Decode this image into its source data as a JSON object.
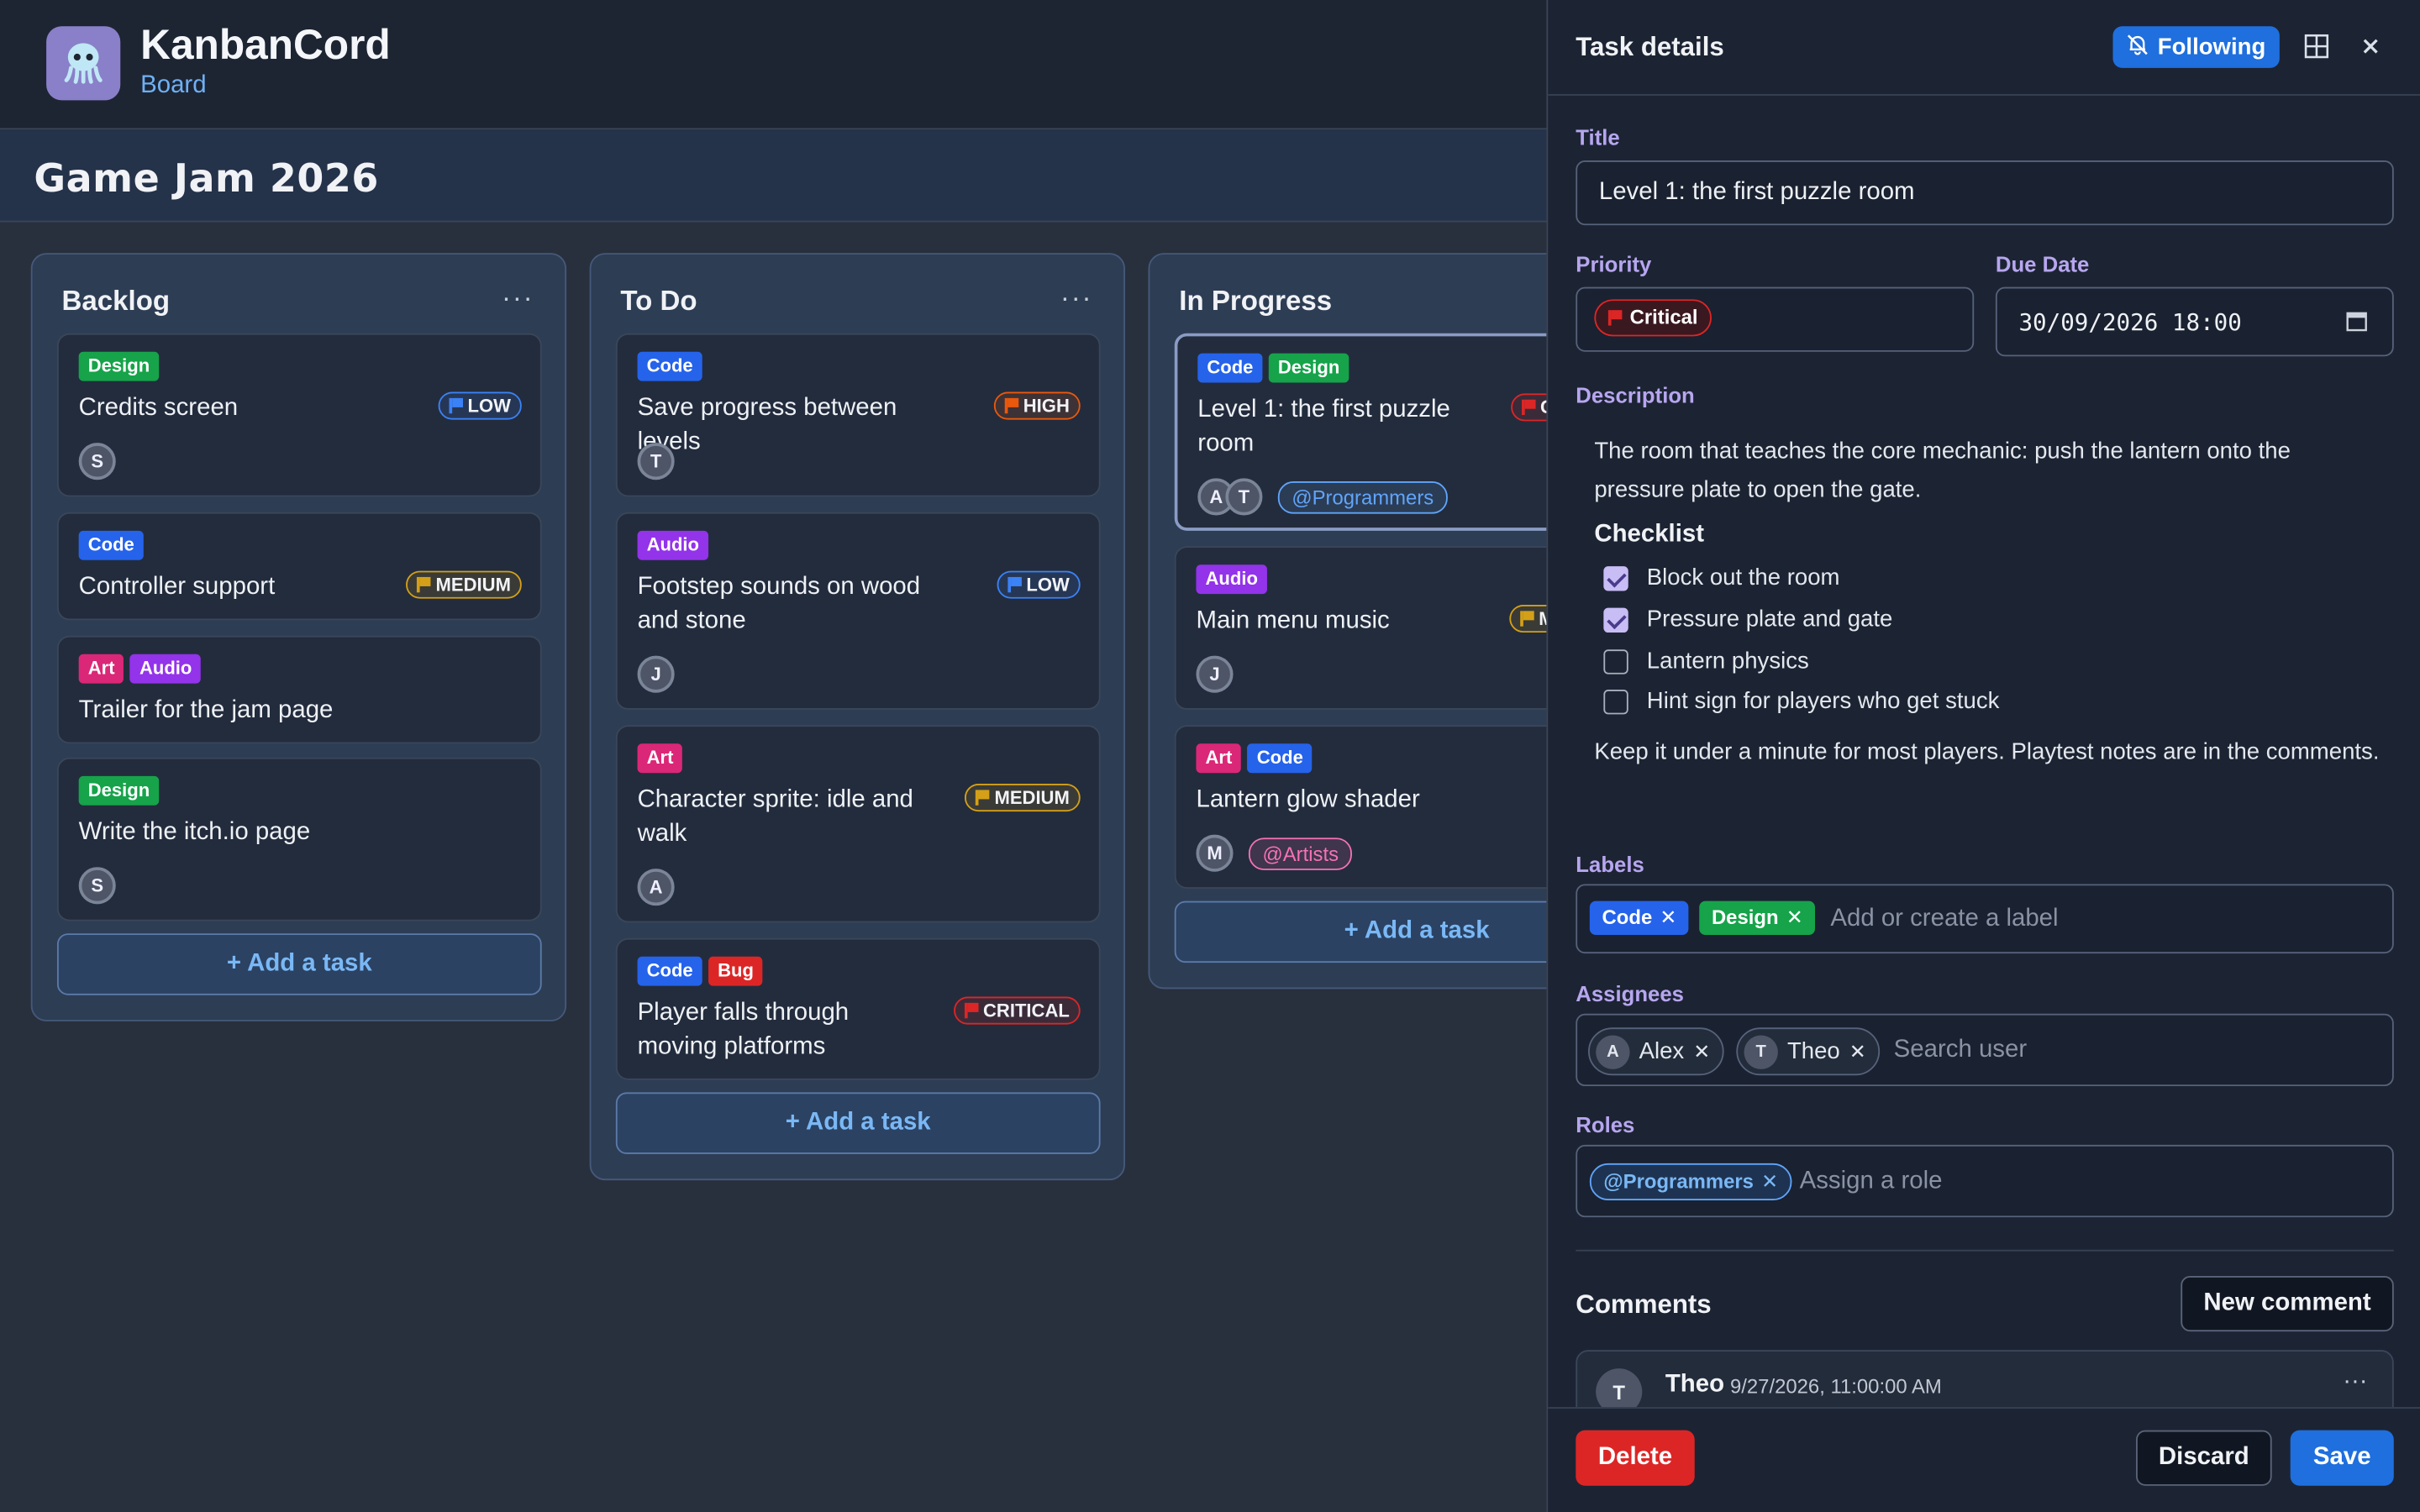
{
  "app": {
    "title": "KanbanCord",
    "subtitle": "Board"
  },
  "board": {
    "title": "Game Jam 2026"
  },
  "add_task_label": "+ Add a task",
  "column_menu": "···",
  "columns": [
    {
      "title": "Backlog",
      "cards": [
        {
          "labels": [
            {
              "text": "Design",
              "color": "#16a34a"
            }
          ],
          "title": "Credits screen",
          "priority": {
            "text": "LOW",
            "color": "#3b82f6"
          },
          "avatars": [
            "S"
          ]
        },
        {
          "labels": [
            {
              "text": "Code",
              "color": "#2563eb"
            }
          ],
          "title": "Controller support",
          "priority": {
            "text": "MEDIUM",
            "color": "#d4a017"
          },
          "avatars": []
        },
        {
          "labels": [
            {
              "text": "Art",
              "color": "#db2777"
            },
            {
              "text": "Audio",
              "color": "#9333ea"
            }
          ],
          "title": "Trailer for the jam page",
          "avatars": []
        },
        {
          "labels": [
            {
              "text": "Design",
              "color": "#16a34a"
            }
          ],
          "title": "Write the itch.io page",
          "avatars": [
            "S"
          ]
        }
      ]
    },
    {
      "title": "To Do",
      "cards": [
        {
          "labels": [
            {
              "text": "Code",
              "color": "#2563eb"
            }
          ],
          "title": "Save progress between levels",
          "priority": {
            "text": "HIGH",
            "color": "#ea580c"
          },
          "avatars": [
            "T"
          ]
        },
        {
          "labels": [
            {
              "text": "Audio",
              "color": "#9333ea"
            }
          ],
          "title": "Footstep sounds on wood and stone",
          "priority": {
            "text": "LOW",
            "color": "#3b82f6"
          },
          "avatars": [
            "J"
          ]
        },
        {
          "labels": [
            {
              "text": "Art",
              "color": "#db2777"
            }
          ],
          "title": "Character sprite: idle and walk",
          "priority": {
            "text": "MEDIUM",
            "color": "#d4a017"
          },
          "avatars": [
            "A"
          ]
        },
        {
          "labels": [
            {
              "text": "Code",
              "color": "#2563eb"
            },
            {
              "text": "Bug",
              "color": "#dc2626"
            }
          ],
          "title": "Player falls through moving platforms",
          "priority": {
            "text": "CRITICAL",
            "color": "#dc2626"
          },
          "avatars": []
        }
      ]
    },
    {
      "title": "In Progress",
      "cards": [
        {
          "labels": [
            {
              "text": "Code",
              "color": "#2563eb"
            },
            {
              "text": "Design",
              "color": "#16a34a"
            }
          ],
          "title": "Level 1: the first puzzle room",
          "priority": {
            "text": "CRITICAL",
            "color": "#dc2626"
          },
          "avatars": [
            "A",
            "T"
          ],
          "role": {
            "text": "@Programmers",
            "color": "#60a5fa"
          }
        },
        {
          "labels": [
            {
              "text": "Audio",
              "color": "#9333ea"
            }
          ],
          "title": "Main menu music",
          "priority": {
            "text": "MEDIUM",
            "color": "#d4a017"
          },
          "avatars": [
            "J"
          ]
        },
        {
          "labels": [
            {
              "text": "Art",
              "color": "#db2777"
            },
            {
              "text": "Code",
              "color": "#2563eb"
            }
          ],
          "title": "Lantern glow shader",
          "avatars": [
            "M"
          ],
          "role": {
            "text": "@Artists",
            "color": "#f472b6"
          }
        }
      ]
    }
  ],
  "panel": {
    "title": "Task details",
    "follow_label": "Following",
    "title_label": "Title",
    "title_value": "Level 1: the first puzzle room",
    "priority_label": "Priority",
    "priority_value": "Critical",
    "due_label": "Due Date",
    "due_value": "30/09/2026 18:00",
    "description_label": "Description",
    "description_intro": "The room that teaches the core mechanic: push the lantern onto the pressure plate to open the gate.",
    "checklist_heading": "Checklist",
    "checklist": [
      {
        "text": "Block out the room",
        "checked": true
      },
      {
        "text": "Pressure plate and gate",
        "checked": true
      },
      {
        "text": "Lantern physics",
        "checked": false
      },
      {
        "text": "Hint sign for players who get stuck",
        "checked": false
      }
    ],
    "description_outro": "Keep it under a minute for most players. Playtest notes are in the comments.",
    "labels_label": "Labels",
    "labels": [
      {
        "text": "Code",
        "color": "#2563eb"
      },
      {
        "text": "Design",
        "color": "#16a34a"
      }
    ],
    "labels_placeholder": "Add or create a label",
    "assignees_label": "Assignees",
    "assignees": [
      {
        "initial": "A",
        "name": "Alex"
      },
      {
        "initial": "T",
        "name": "Theo"
      }
    ],
    "assignees_placeholder": "Search user",
    "roles_label": "Roles",
    "roles": [
      {
        "text": "@Programmers"
      }
    ],
    "roles_placeholder": "Assign a role",
    "comments_label": "Comments",
    "new_comment_label": "New comment",
    "comment": {
      "initial": "T",
      "author": "Theo",
      "time": "9/27/2026, 11:00:00 AM",
      "menu": "···"
    },
    "delete_label": "Delete",
    "discard_label": "Discard",
    "save_label": "Save"
  }
}
